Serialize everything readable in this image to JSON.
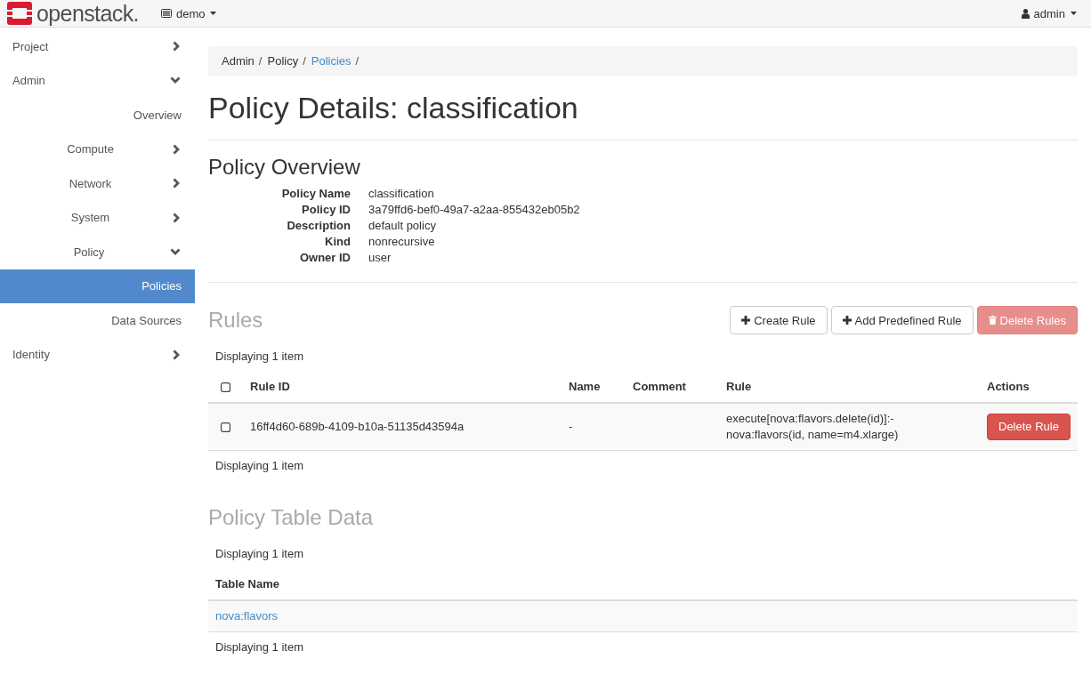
{
  "navbar": {
    "brand": "openstack.",
    "project_menu": "demo",
    "user_menu": "admin"
  },
  "sidebar": {
    "items": [
      {
        "label": "Project",
        "kind": "group",
        "expanded": false,
        "selected": false
      },
      {
        "label": "Admin",
        "kind": "group",
        "expanded": true,
        "selected": false,
        "children": [
          {
            "label": "Overview",
            "kind": "link",
            "selected": false
          },
          {
            "label": "Compute",
            "kind": "group",
            "expanded": false,
            "selected": false
          },
          {
            "label": "Network",
            "kind": "group",
            "expanded": false,
            "selected": false
          },
          {
            "label": "System",
            "kind": "group",
            "expanded": false,
            "selected": false
          },
          {
            "label": "Policy",
            "kind": "group",
            "expanded": true,
            "selected": false,
            "children": [
              {
                "label": "Policies",
                "kind": "link",
                "selected": true
              },
              {
                "label": "Data Sources",
                "kind": "link",
                "selected": false
              }
            ]
          }
        ]
      },
      {
        "label": "Identity",
        "kind": "group",
        "expanded": false,
        "selected": false
      }
    ]
  },
  "breadcrumb": [
    {
      "label": "Admin",
      "link": false,
      "separator": "/"
    },
    {
      "label": "Policy",
      "link": false,
      "separator": "/"
    },
    {
      "label": "Policies",
      "link": true,
      "separator": "/"
    }
  ],
  "page_title": "Policy Details: classification",
  "overview": {
    "title": "Policy Overview",
    "fields": [
      {
        "label": "Policy Name",
        "value": "classification"
      },
      {
        "label": "Policy ID",
        "value": "3a79ffd6-bef0-49a7-a2aa-855432eb05b2"
      },
      {
        "label": "Description",
        "value": "default policy"
      },
      {
        "label": "Kind",
        "value": "nonrecursive"
      },
      {
        "label": "Owner ID",
        "value": "user"
      }
    ]
  },
  "rules": {
    "title": "Rules",
    "actions": [
      {
        "label": "Create Rule",
        "kind": "add",
        "disabled": false
      },
      {
        "label": "Add Predefined Rule",
        "kind": "add",
        "disabled": false
      },
      {
        "label": "Delete Rules",
        "kind": "delete",
        "disabled": true
      }
    ],
    "count_top": "Displaying 1 item",
    "table": {
      "select_all": {
        "checked": false
      },
      "columns": [
        "Rule ID",
        "Name",
        "Comment",
        "Rule",
        "Actions"
      ],
      "rows": [
        {
          "checked": false,
          "rule_id": "16ff4d60-689b-4109-b10a-51135d43594a",
          "name": "-",
          "rule": "execute[nova:flavors.delete(id)]:- nova:flavors(id, name=m4.xlarge)",
          "action": "Delete Rule"
        }
      ]
    },
    "count_bottom": "Displaying 1 item"
  },
  "table_data": {
    "title": "Policy Table Data",
    "count_top": "Displaying 1 item",
    "columns": [
      "Table Name"
    ],
    "rows": [
      {
        "table_name": "nova:flavors"
      }
    ],
    "count_bottom": "Displaying 1 item"
  }
}
